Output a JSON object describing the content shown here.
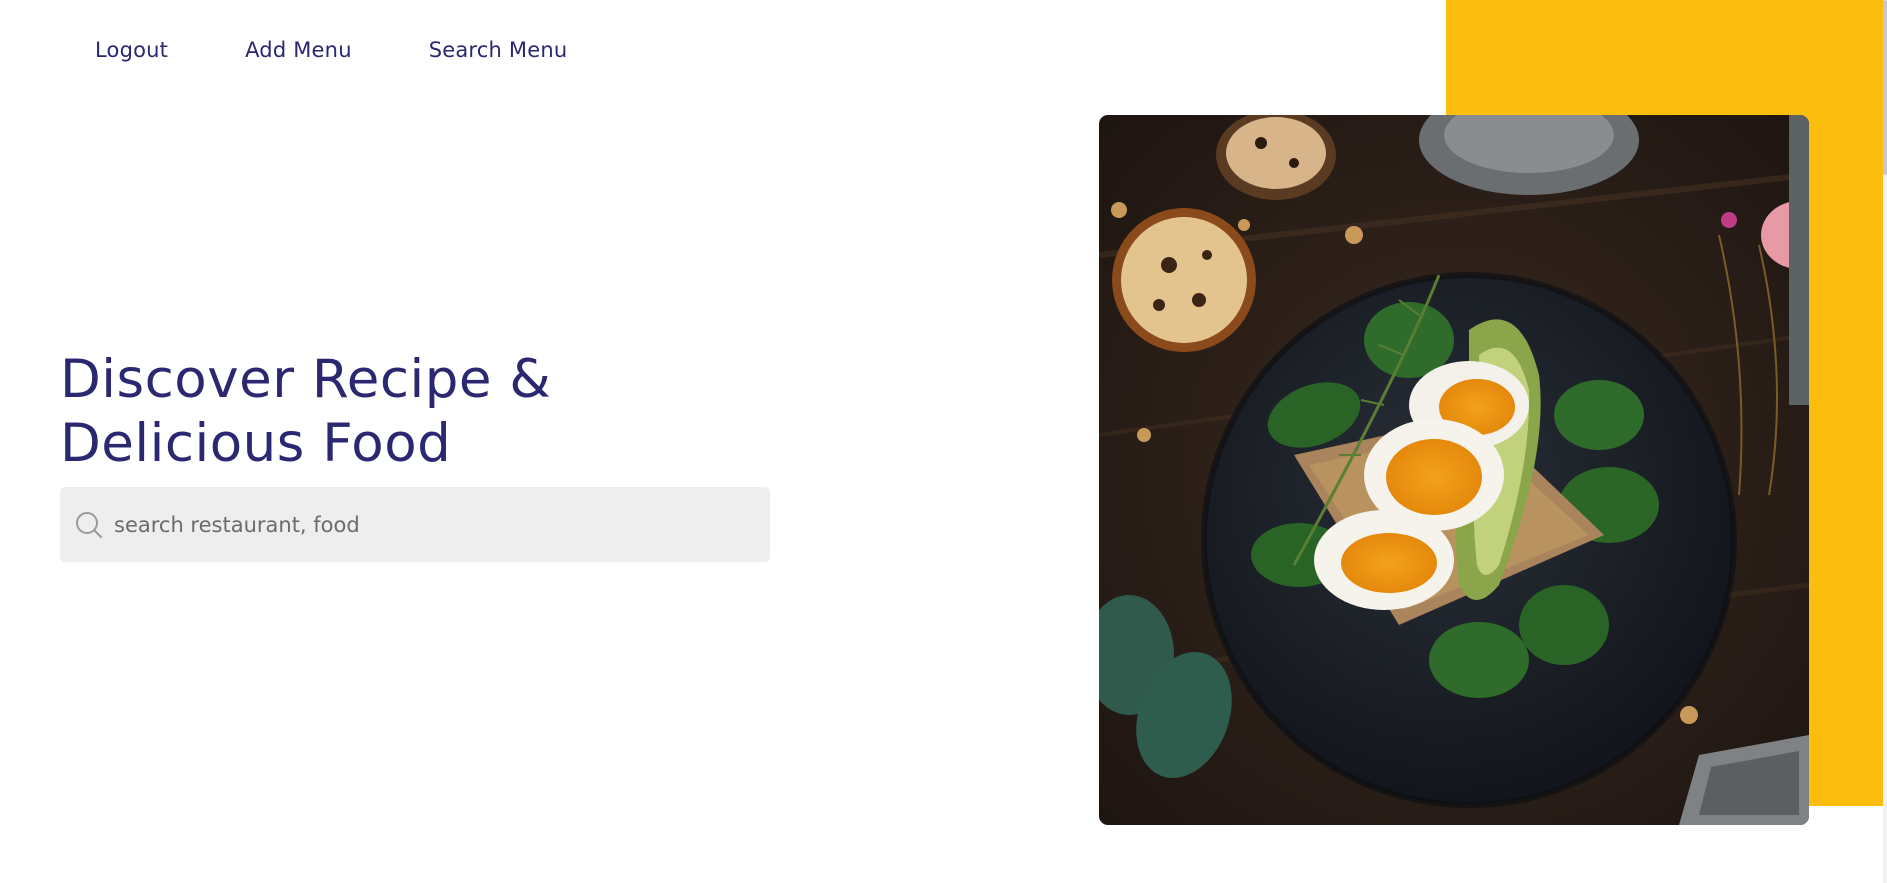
{
  "nav": {
    "items": [
      {
        "label": "Logout"
      },
      {
        "label": "Add Menu"
      },
      {
        "label": "Search Menu"
      }
    ]
  },
  "hero": {
    "title_line1": "Discover Recipe &",
    "title_line2": "Delicious Food"
  },
  "search": {
    "placeholder": "search restaurant, food",
    "value": "",
    "icon": "search-icon"
  },
  "colors": {
    "accent": "#fbbd0e",
    "text_primary": "#2b2770",
    "search_bg": "#eeeeee"
  },
  "image": {
    "subject": "food-photo-icon"
  }
}
